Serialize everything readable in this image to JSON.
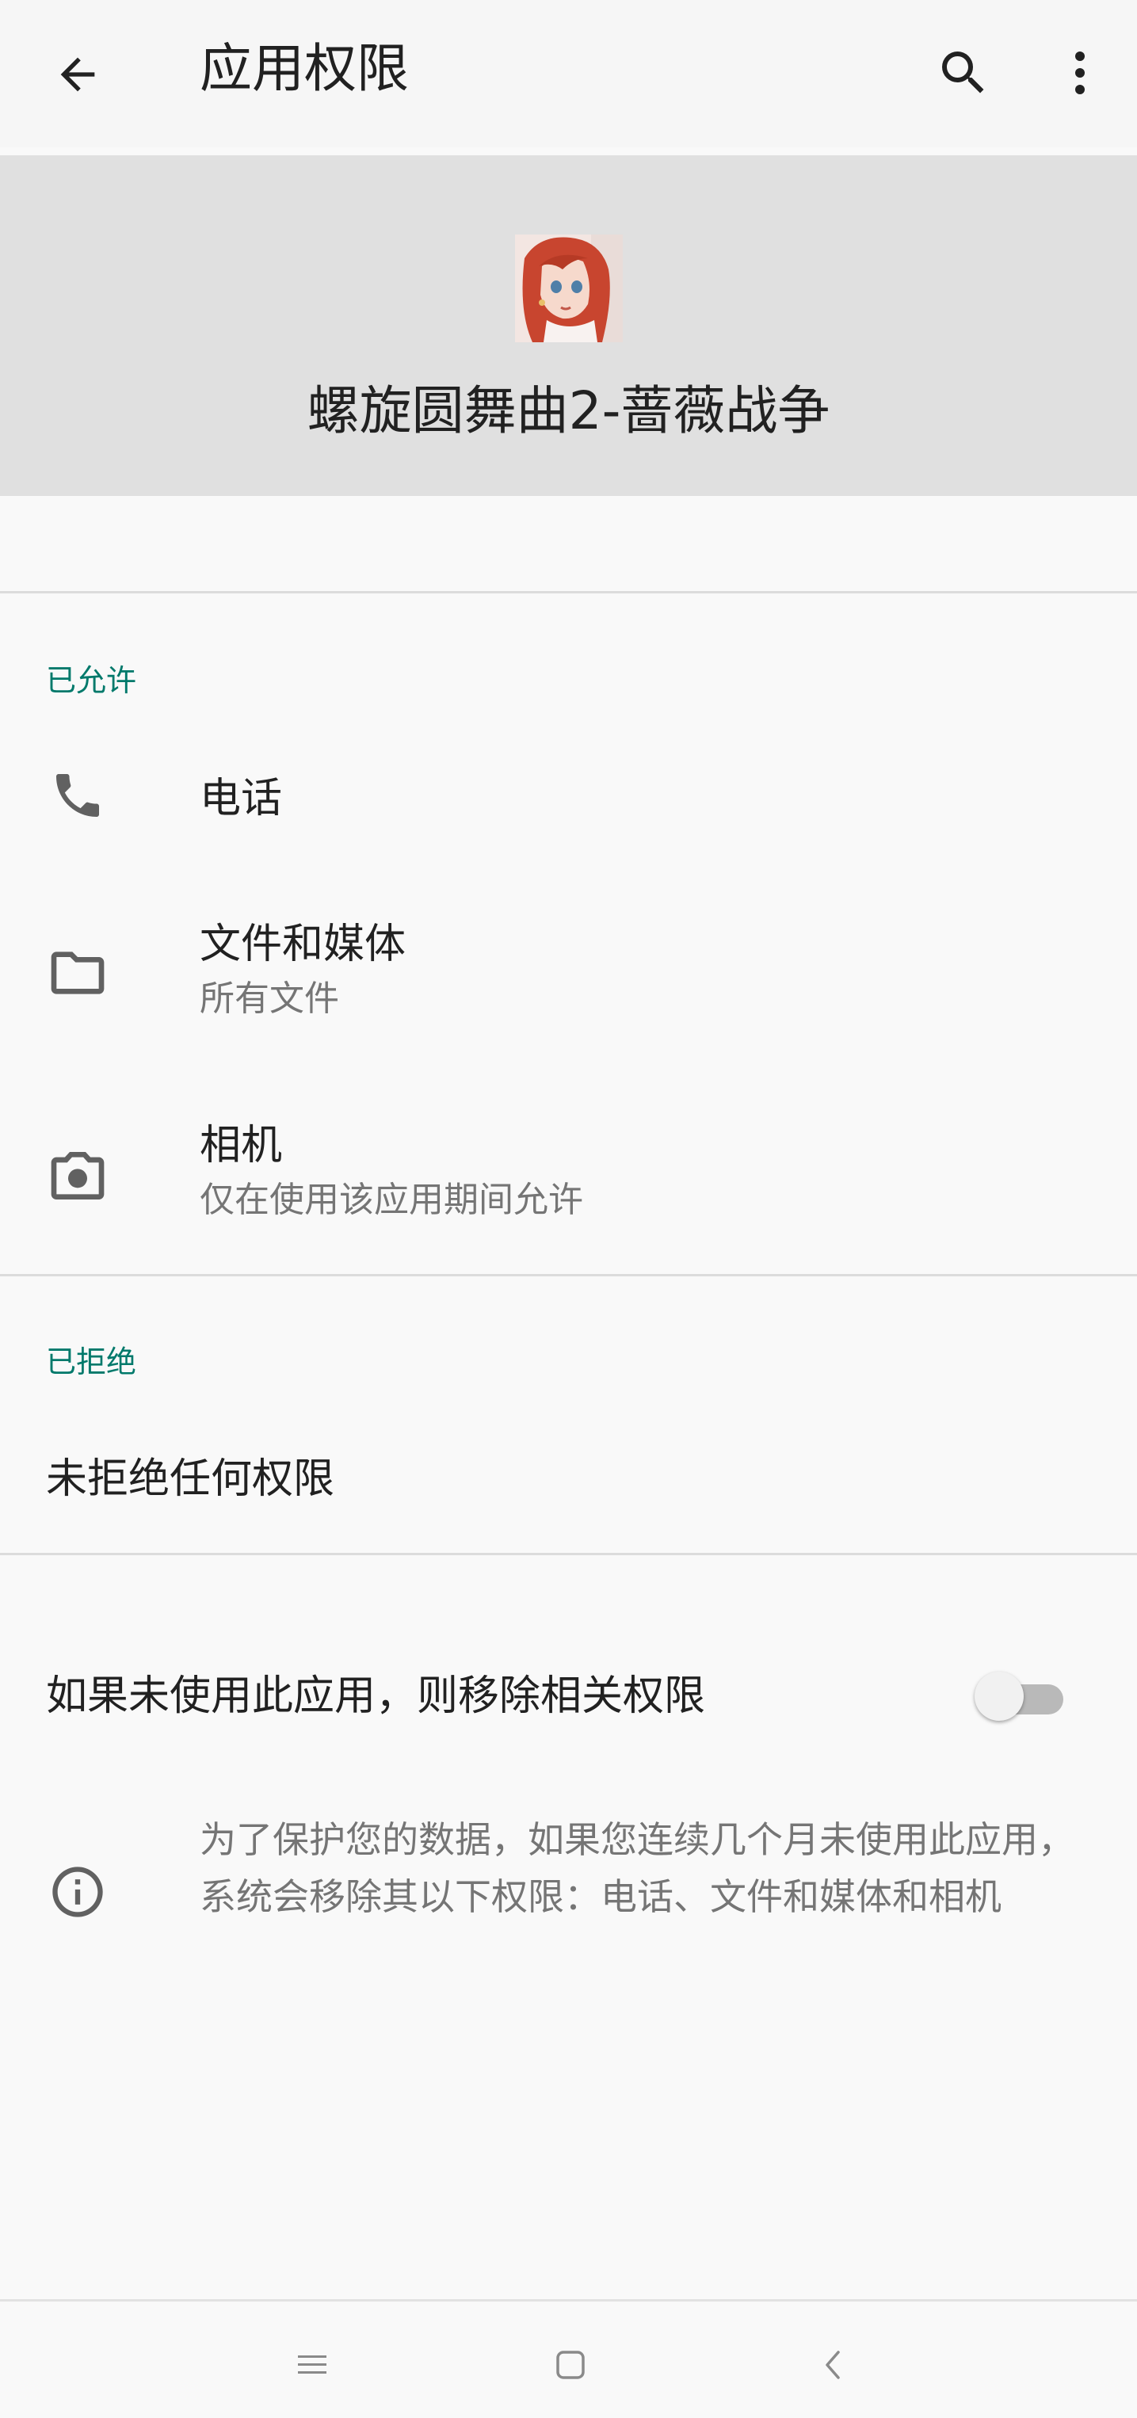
{
  "appbar": {
    "title": "应用权限",
    "back_icon": "arrow-back-icon",
    "search_icon": "search-icon",
    "more_icon": "more-vert-icon"
  },
  "app": {
    "name": "螺旋圆舞曲2-蔷薇战争",
    "icon": "app-avatar-icon"
  },
  "allowed": {
    "title": "已允许",
    "items": [
      {
        "icon": "phone-icon",
        "label": "电话",
        "summary": ""
      },
      {
        "icon": "folder-icon",
        "label": "文件和媒体",
        "summary": "所有文件"
      },
      {
        "icon": "camera-icon",
        "label": "相机",
        "summary": "仅在使用该应用期间允许"
      }
    ]
  },
  "denied": {
    "title": "已拒绝",
    "empty_text": "未拒绝任何权限"
  },
  "auto_revoke": {
    "label": "如果未使用此应用，则移除相关权限",
    "enabled": false
  },
  "info": {
    "icon": "info-icon",
    "text": "为了保护您的数据，如果您连续几个月未使用此应用，系统会移除其以下权限：电话、文件和媒体和相机"
  },
  "navbar": {
    "menu_icon": "menu-icon",
    "home_icon": "home-square-icon",
    "back_icon": "back-chevron-icon"
  },
  "colors": {
    "accent": "#00796b",
    "header_bg": "#e0e0e0",
    "background": "#f9f9f9",
    "icon_gray": "#616161"
  }
}
